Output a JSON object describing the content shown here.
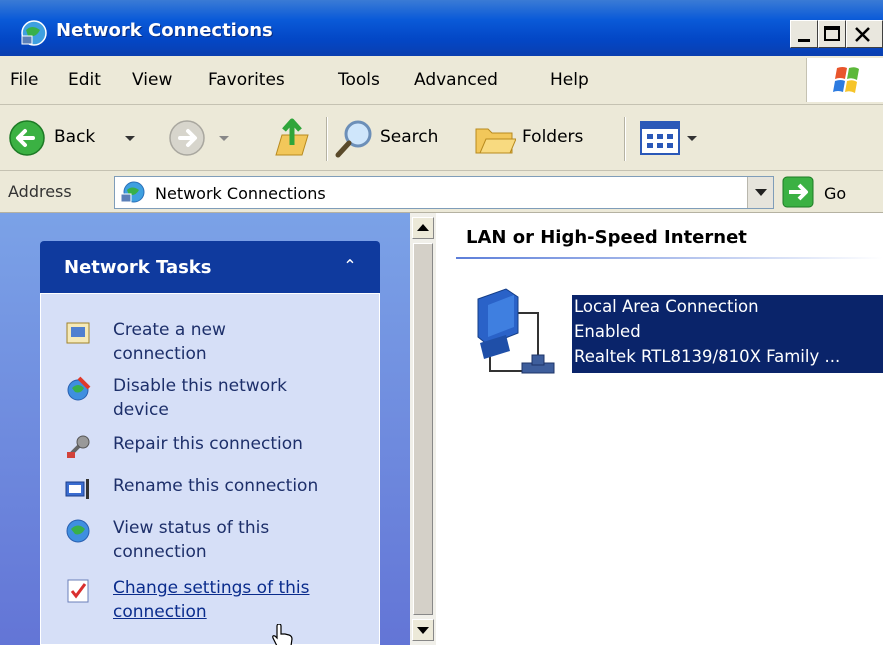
{
  "window": {
    "title": "Network Connections"
  },
  "menu": {
    "items": [
      "File",
      "Edit",
      "View",
      "Favorites",
      "Tools",
      "Advanced",
      "Help"
    ]
  },
  "toolbar": {
    "back_label": "Back",
    "search_label": "Search",
    "folders_label": "Folders"
  },
  "address": {
    "label": "Address",
    "value": "Network Connections",
    "go_label": "Go"
  },
  "tasks": {
    "title": "Network Tasks",
    "collapse_glyph": "⌃",
    "items": [
      {
        "label": "Create a new\nconnection",
        "icon": "new-connection-icon"
      },
      {
        "label": "Disable this network\ndevice",
        "icon": "disable-network-icon"
      },
      {
        "label": "Repair this connection",
        "icon": "repair-icon"
      },
      {
        "label": "Rename this connection",
        "icon": "rename-icon"
      },
      {
        "label": "View status of this\nconnection",
        "icon": "status-icon"
      },
      {
        "label": "Change settings of this\nconnection",
        "icon": "settings-icon"
      }
    ]
  },
  "content": {
    "group_header": "LAN or High-Speed Internet",
    "connection": {
      "name": "Local Area Connection",
      "status": "Enabled",
      "device": "Realtek RTL8139/810X Family ..."
    }
  },
  "colors": {
    "titlebar": "#0347c6",
    "taskbox_header": "#0f3a9e",
    "selection": "#0a246a",
    "chrome": "#ece9d8"
  }
}
